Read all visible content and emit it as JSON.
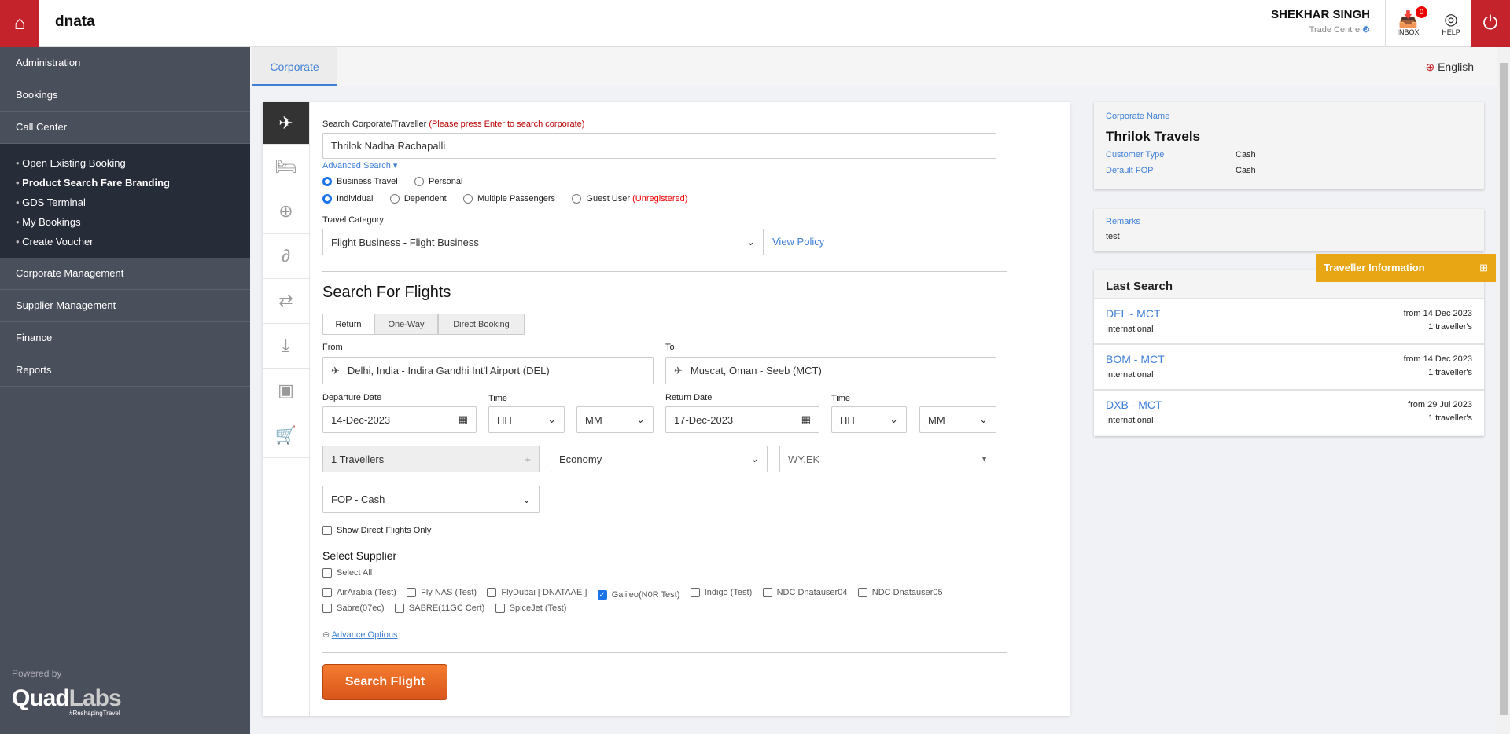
{
  "header": {
    "brand": "dnata",
    "user_name": "SHEKHAR SINGH",
    "user_sub": "Trade Centre",
    "inbox_label": "INBOX",
    "inbox_count": "0",
    "help_label": "HELP"
  },
  "sidebar": {
    "items": [
      "Administration",
      "Bookings",
      "Call Center"
    ],
    "sub_items": [
      "Open Existing Booking",
      "Product Search Fare Branding",
      "GDS Terminal",
      "My Bookings",
      "Create Voucher"
    ],
    "items2": [
      "Corporate Management",
      "Supplier Management",
      "Finance",
      "Reports"
    ],
    "powered_by": "Powered by",
    "logo_text": "QuadLabs",
    "logo_tag": "#ReshapingTravel"
  },
  "tabs": {
    "corporate": "Corporate",
    "language": "English"
  },
  "form": {
    "search_label": "Search Corporate/Traveller",
    "search_hint": "(Please press Enter to search corporate)",
    "search_value": "Thrilok Nadha Rachapalli",
    "advanced_search": "Advanced Search ▾",
    "travel_type": [
      "Business Travel",
      "Personal"
    ],
    "pax_type": [
      "Individual",
      "Dependent",
      "Multiple Passengers",
      "Guest User"
    ],
    "unregistered": "(Unregistered)",
    "travel_category_label": "Travel Category",
    "travel_category": "Flight Business - Flight Business",
    "view_policy": "View Policy",
    "section_title": "Search For Flights",
    "trip_tabs": [
      "Return",
      "One-Way",
      "Direct Booking"
    ],
    "from_label": "From",
    "from_value": "Delhi, India - Indira Gandhi Int'l Airport (DEL)",
    "to_label": "To",
    "to_value": "Muscat, Oman - Seeb (MCT)",
    "dep_label": "Departure Date",
    "dep_value": "14-Dec-2023",
    "time_label": "Time",
    "hh": "HH",
    "mm": "MM",
    "ret_label": "Return Date",
    "ret_value": "17-Dec-2023",
    "travellers": "1 Travellers",
    "cabin": "Economy",
    "airlines": "WY,EK",
    "fop": "FOP - Cash",
    "direct_only": "Show Direct Flights Only",
    "supplier_title": "Select Supplier",
    "select_all": "Select All",
    "suppliers": [
      "AirArabia (Test)",
      "Fly NAS (Test)",
      "FlyDubai [ DNATAAE ]",
      "Galileo(N0R Test)",
      "Indigo (Test)",
      "NDC Dnatauser04",
      "NDC Dnatauser05",
      "Sabre(07ec)",
      "SABRE(11GC Cert)",
      "SpiceJet (Test)"
    ],
    "advance_options": "Advance Options",
    "search_button": "Search Flight"
  },
  "right": {
    "corp_label": "Corporate Name",
    "corp_name": "Thrilok Travels",
    "cust_type_label": "Customer Type",
    "cust_type": "Cash",
    "fop_label": "Default FOP",
    "fop": "Cash",
    "remarks_label": "Remarks",
    "remarks": "test",
    "traveller_info": "Traveller Information",
    "last_search": "Last Search",
    "searches": [
      {
        "route": "DEL - MCT",
        "type": "International",
        "date": "from 14 Dec 2023",
        "pax": "1 traveller's"
      },
      {
        "route": "BOM - MCT",
        "type": "International",
        "date": "from 14 Dec 2023",
        "pax": "1 traveller's"
      },
      {
        "route": "DXB - MCT",
        "type": "International",
        "date": "from 29 Jul 2023",
        "pax": "1 traveller's"
      }
    ]
  },
  "colors": {
    "brand_red": "#c4232b",
    "accent_blue": "#3f7fd6",
    "orange": "#e8621f",
    "gold": "#e8a614"
  }
}
